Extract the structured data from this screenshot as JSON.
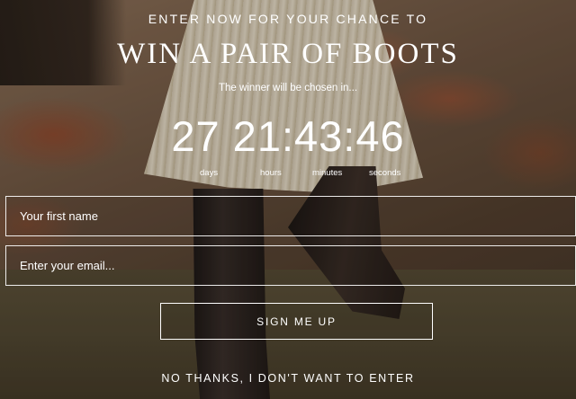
{
  "popup": {
    "eyebrow": "ENTER NOW FOR YOUR CHANCE TO",
    "title": "WIN A PAIR OF BOOTS",
    "subtitle": "The winner will be chosen in...",
    "countdown": {
      "display": "27 21:43:46",
      "days_label": "days",
      "hours_label": "hours",
      "minutes_label": "minutes",
      "seconds_label": "seconds"
    },
    "form": {
      "first_name_placeholder": "Your first name",
      "email_placeholder": "Enter your email..."
    },
    "signup_label": "SIGN ME UP",
    "decline_label": "NO THANKS, I DON'T WANT TO ENTER"
  }
}
